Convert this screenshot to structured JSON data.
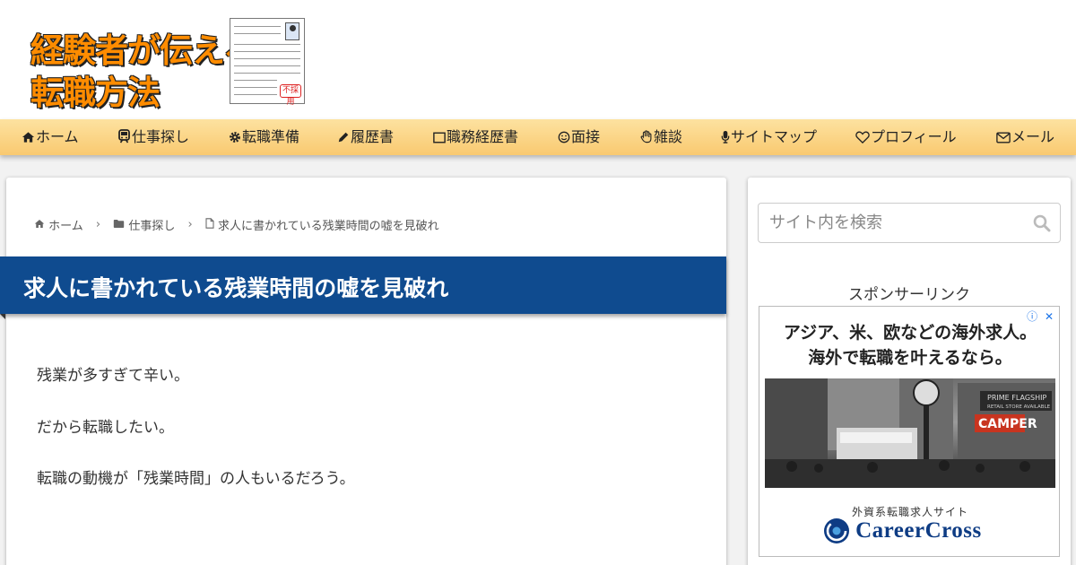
{
  "logo": {
    "line1": "経験者が伝える",
    "line2": "転職方法",
    "stamp": "不採用"
  },
  "nav": [
    {
      "label": "ホーム",
      "icon": "home-icon"
    },
    {
      "label": "仕事探し",
      "icon": "train-icon"
    },
    {
      "label": "転職準備",
      "icon": "gear-icon"
    },
    {
      "label": "履歴書",
      "icon": "pencil-icon"
    },
    {
      "label": "職務経歴書",
      "icon": "window-icon"
    },
    {
      "label": "面接",
      "icon": "smile-icon"
    },
    {
      "label": "雑談",
      "icon": "hand-icon"
    },
    {
      "label": "サイトマップ",
      "icon": "microphone-icon"
    },
    {
      "label": "プロフィール",
      "icon": "heart-icon"
    },
    {
      "label": "メール",
      "icon": "mail-icon"
    }
  ],
  "breadcrumb": {
    "home": "ホーム",
    "category": "仕事探し",
    "current": "求人に書かれている残業時間の嘘を見破れ"
  },
  "article": {
    "title": "求人に書かれている残業時間の嘘を見破れ",
    "paragraphs": [
      "残業が多すぎて辛い。",
      "だから転職したい。",
      "転職の動機が「残業時間」の人もいるだろう。"
    ]
  },
  "sidebar": {
    "search_placeholder": "サイト内を検索",
    "sponsor_label": "スポンサーリンク",
    "ad": {
      "headline1": "アジア、米、欧などの海外求人。",
      "headline2": "海外で転職を叶えるなら。",
      "subtitle": "外資系転職求人サイト",
      "brand": "CareerCross",
      "photo_sign1": "PRIME FLAGSHIP",
      "photo_sign2": "RETAIL STORE AVAILABLE",
      "photo_sign3": "CAMPER",
      "info_icons": "ⓘ ✕"
    }
  },
  "colors": {
    "title_bar": "#0f4b8f",
    "nav_bg": "#f9c970",
    "logo_orange": "#ff8c00",
    "brand_blue": "#0e3c84"
  }
}
